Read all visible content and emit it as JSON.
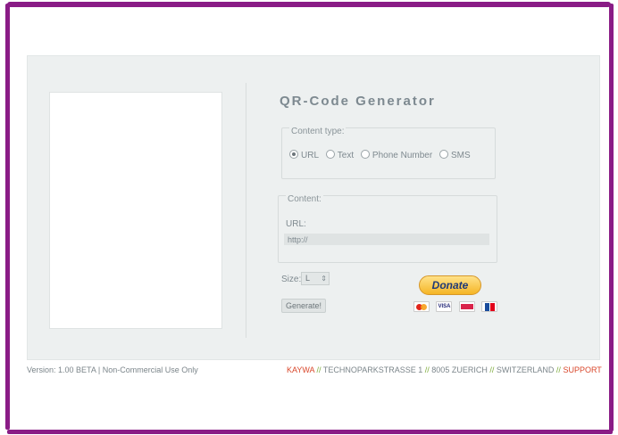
{
  "app": {
    "title": "QR-Code Generator"
  },
  "content_type": {
    "legend": "Content type:",
    "options": [
      {
        "label": "URL",
        "checked": true
      },
      {
        "label": "Text",
        "checked": false
      },
      {
        "label": "Phone Number",
        "checked": false
      },
      {
        "label": "SMS",
        "checked": false
      }
    ]
  },
  "content": {
    "legend": "Content:",
    "url_label": "URL:",
    "url_value": "http://"
  },
  "size": {
    "label": "Size:",
    "value": "L",
    "arrows": "⇕"
  },
  "generate": {
    "label": "Generate!"
  },
  "donate": {
    "label": "Donate",
    "cards": [
      "mastercard-icon",
      "visa-icon",
      "postfinance-icon",
      "ec-icon"
    ],
    "visa_text": "VISA"
  },
  "footer": {
    "version": "Version: 1.00 BETA | Non-Commercial Use Only",
    "company": "KAYWA",
    "sep": "//",
    "street": "TECHNOPARKSTRASSE 1",
    "city": "8005 ZUERICH",
    "country": "SWITZERLAND",
    "support": "SUPPORT"
  },
  "colors": {
    "frame": "#8a1c86",
    "panel": "#edf0f0",
    "accent_red": "#d9472b",
    "accent_green": "#7cab3a"
  }
}
